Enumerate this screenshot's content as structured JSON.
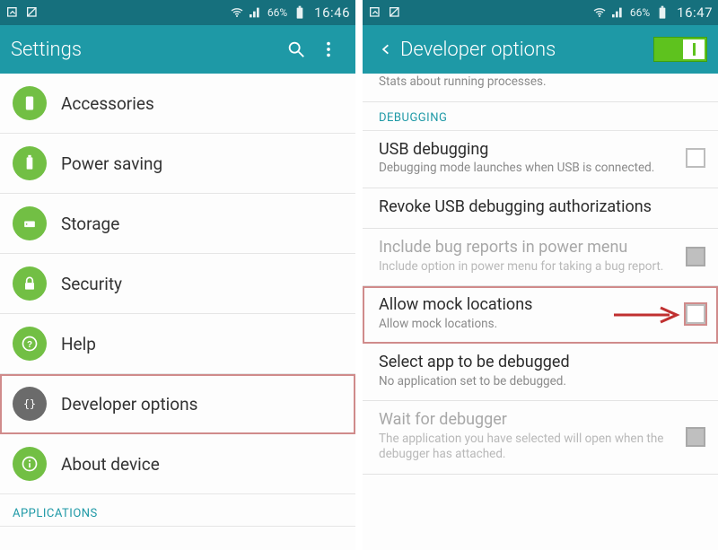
{
  "left": {
    "status": {
      "battery": "66%",
      "time": "16:46"
    },
    "appbar": {
      "title": "Settings"
    },
    "items": [
      {
        "label": "Accessories",
        "color": "green"
      },
      {
        "label": "Power saving",
        "color": "green"
      },
      {
        "label": "Storage",
        "color": "green"
      },
      {
        "label": "Security",
        "color": "green"
      },
      {
        "label": "Help",
        "color": "green"
      },
      {
        "label": "Developer options",
        "color": "gray",
        "highlight": true
      },
      {
        "label": "About device",
        "color": "green"
      }
    ],
    "section": "APPLICATIONS"
  },
  "right": {
    "status": {
      "battery": "66%",
      "time": "16:47"
    },
    "appbar": {
      "title": "Developer options"
    },
    "top_truncated": {
      "sub": "Stats about running processes."
    },
    "section": "DEBUGGING",
    "prefs": [
      {
        "title": "USB debugging",
        "sub": "Debugging mode launches when USB is connected.",
        "checkbox": true
      },
      {
        "title": "Revoke USB debugging authorizations"
      },
      {
        "title": "Include bug reports in power menu",
        "sub": "Include option in power menu for taking a bug report.",
        "checkbox": true,
        "disabled": true
      },
      {
        "title": "Allow mock locations",
        "sub": "Allow mock locations.",
        "checkbox": true,
        "highlight": true
      },
      {
        "title": "Select app to be debugged",
        "sub": "No application set to be debugged."
      },
      {
        "title": "Wait for debugger",
        "sub": "The application you have selected will open when the debugger has attached.",
        "checkbox": true,
        "disabled": true
      }
    ]
  }
}
